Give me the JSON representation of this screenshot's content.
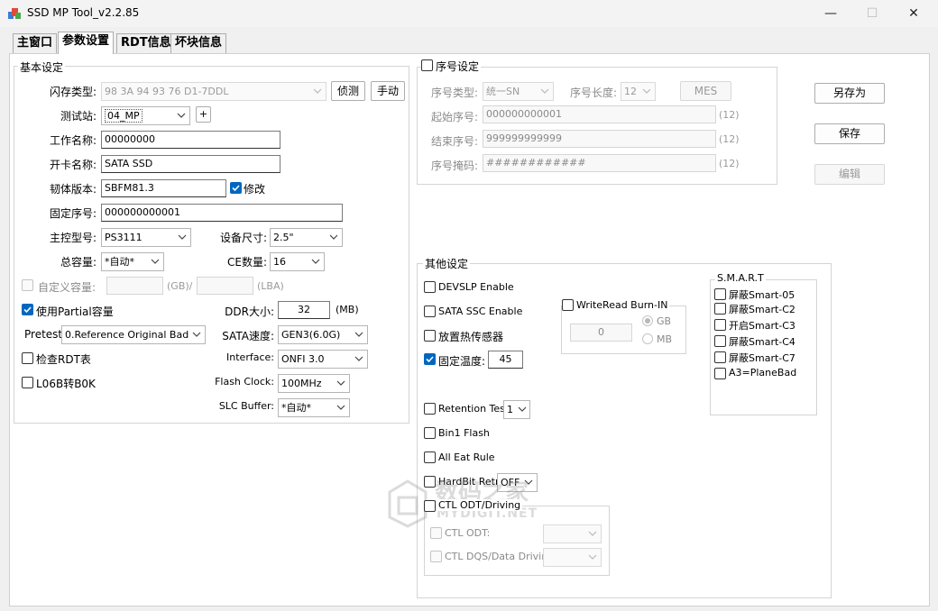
{
  "window": {
    "title": "SSD MP Tool_v2.2.85",
    "minimize": "—",
    "maximize": "☐",
    "close": "✕"
  },
  "tabs": [
    "主窗口",
    "参数设置",
    "RDT信息",
    "坏块信息"
  ],
  "basic": {
    "group_label": "基本设定",
    "flash_type_label": "闪存类型:",
    "flash_type_value": "98 3A 94 93 76 D1-7DDL",
    "detect_button": "侦测",
    "manual_button": "手动",
    "station_label": "测试站:",
    "station_value": "04_MP",
    "plus_button": "+",
    "work_name_label": "工作名称:",
    "work_name_value": "00000000",
    "card_name_label": "开卡名称:",
    "card_name_value": "SATA SSD",
    "fw_label": "韧体版本:",
    "fw_value": "SBFM81.3",
    "fw_modify_label": "修改",
    "fixed_sn_label": "固定序号:",
    "fixed_sn_value": "000000000001",
    "controller_label": "主控型号:",
    "controller_value": "PS3111",
    "device_size_label": "设备尺寸:",
    "device_size_value": "2.5\"",
    "capacity_label": "总容量:",
    "capacity_value": "*自动*",
    "ce_label": "CE数量:",
    "ce_value": "16",
    "custom_capacity_label": "自定义容量:",
    "custom_capacity_unit1": "(GB)/",
    "custom_capacity_unit2": "(LBA)",
    "use_partial_label": "使用Partial容量",
    "ddr_label": "DDR大小:",
    "ddr_value": "32",
    "ddr_unit": "(MB)",
    "pretest_label": "Pretest:",
    "pretest_value": "0.Reference Original Bad",
    "sata_speed_label": "SATA速度:",
    "sata_speed_value": "GEN3(6.0G)",
    "check_rdt_label": "检查RDT表",
    "interface_label": "Interface:",
    "interface_value": "ONFI 3.0",
    "l06b_label": "L06B转B0K",
    "flash_clock_label": "Flash Clock:",
    "flash_clock_value": "100MHz",
    "slc_buffer_label": "SLC Buffer:",
    "slc_buffer_value": "*自动*"
  },
  "serial": {
    "group_label": "序号设定",
    "type_label": "序号类型:",
    "type_value": "统一SN",
    "length_label": "序号长度:",
    "length_value": "12",
    "mes_button": "MES",
    "start_label": "起始序号:",
    "start_value": "000000000001",
    "start_len": "(12)",
    "end_label": "结束序号:",
    "end_value": "999999999999",
    "end_len": "(12)",
    "mask_label": "序号掩码:",
    "mask_value": "############",
    "mask_len": "(12)"
  },
  "side_buttons": {
    "save_as": "另存为",
    "save": "保存",
    "edit": "编辑"
  },
  "other": {
    "group_label": "其他设定",
    "devslp": "DEVSLP Enable",
    "sata_ssc": "SATA SSC Enable",
    "thermal": "放置热传感器",
    "fixed_temp": "固定温度:",
    "fixed_temp_value": "45",
    "writeread_label": "WriteRead Burn-IN",
    "writeread_value": "0",
    "gb": "GB",
    "mb": "MB",
    "retention": "Retention Test",
    "retention_value": "1",
    "bin1": "Bin1 Flash",
    "all_eat": "All Eat Rule",
    "hardbit": "HardBit Retry",
    "hardbit_value": "OFF",
    "ctl_group": "CTL ODT/Driving",
    "ctl_odt": "CTL ODT:",
    "ctl_dqs": "CTL DQS/Data Driving:"
  },
  "smart": {
    "group_label": "S.M.A.R.T",
    "items": [
      "屏蔽Smart-05",
      "屏蔽Smart-C2",
      "开启Smart-C3",
      "屏蔽Smart-C4",
      "屏蔽Smart-C7",
      "A3=PlaneBad"
    ]
  },
  "watermark": {
    "line1": "数码之家",
    "line2": "MYDIGIT.NET"
  },
  "colors": {
    "accent": "#0067c0",
    "panel": "#ffffff",
    "window": "#f0f0f0"
  }
}
